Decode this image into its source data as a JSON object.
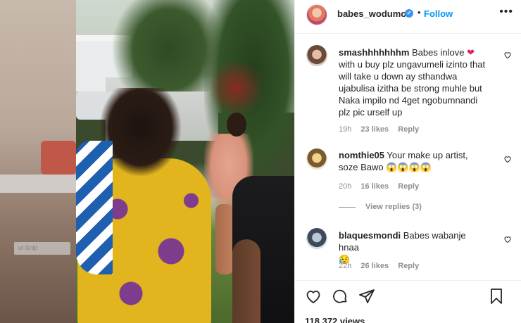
{
  "header": {
    "username": "babes_wodumo",
    "verified_mark": "✓",
    "separator": "•",
    "follow_label": "Follow",
    "more_label": "•••"
  },
  "media": {
    "watermark_text": "ul Snip"
  },
  "comments": [
    {
      "username": "smashhhhhhhm",
      "text": "Babes inlove",
      "text_after_emoji": "with u buy plz ungavumeli izinto that will take u down ay sthandwa ujabulisa izitha be strong muhle but Naka impilo nd 4get ngobumnandi plz pic urself up",
      "emoji": "❤",
      "time": "19h",
      "likes": "23 likes",
      "reply": "Reply"
    },
    {
      "username": "nomthie05",
      "text": "Your make up artist, soze Bawo",
      "emoji": "😱😱😱😱",
      "time": "20h",
      "likes": "16 likes",
      "reply": "Reply",
      "view_replies": "View replies (3)"
    },
    {
      "username": "blaquesmondi",
      "text": "Babes wabanje hnaa",
      "emoji": "😥",
      "time": "22h",
      "likes": "26 likes",
      "reply": "Reply"
    }
  ],
  "actions": {
    "like_icon": "heart-outline-icon",
    "comment_icon": "comment-bubble-icon",
    "share_icon": "paper-plane-icon",
    "save_icon": "bookmark-icon"
  },
  "views": "118,372 views",
  "colors": {
    "follow": "#0095f6",
    "verified": "#3897f0",
    "muted": "#8e8e8e",
    "text": "#262626"
  }
}
